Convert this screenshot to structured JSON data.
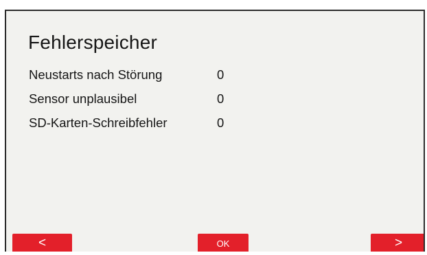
{
  "screen": {
    "title": "Fehlerspeicher"
  },
  "error_log": {
    "rows": [
      {
        "label": "Neustarts nach Störung",
        "value": "0"
      },
      {
        "label": "Sensor unplausibel",
        "value": "0"
      },
      {
        "label": "SD-Karten-Schreibfehler",
        "value": "0"
      }
    ]
  },
  "nav": {
    "prev_label": "<",
    "ok_label": "OK",
    "next_label": ">"
  },
  "colors": {
    "button_accent": "#e3202a",
    "screen_background": "#f2f2ef",
    "text": "#151515"
  }
}
